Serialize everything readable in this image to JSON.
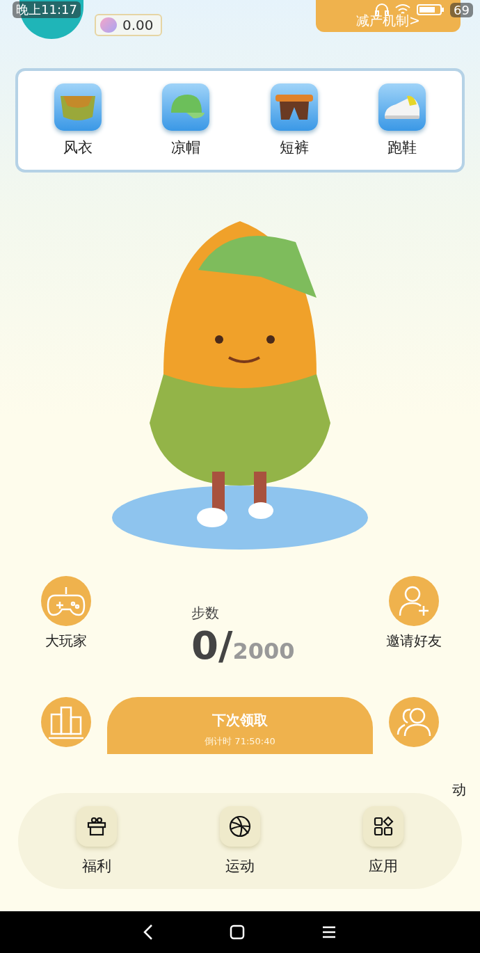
{
  "status_bar": {
    "time": "晚上11:17",
    "battery": "69"
  },
  "header": {
    "balance": "0.00",
    "mechanism_button": "减产机制>"
  },
  "outfits": [
    {
      "label": "风衣",
      "kind": "jacket"
    },
    {
      "label": "凉帽",
      "kind": "cap"
    },
    {
      "label": "短裤",
      "kind": "shorts"
    },
    {
      "label": "跑鞋",
      "kind": "shoe"
    }
  ],
  "steps": {
    "label": "步数",
    "current": "0/",
    "goal": "2000"
  },
  "side_actions": [
    {
      "label": "大玩家",
      "kind": "gamepad"
    },
    {
      "label": "邀请好友",
      "kind": "add-user"
    },
    {
      "kind": "podium"
    },
    {
      "label": "动",
      "kind": "users"
    }
  ],
  "claim_button": {
    "title": "下次领取",
    "countdown": "倒计时 71:50:40"
  },
  "dock": [
    {
      "label": "福利",
      "kind": "gift"
    },
    {
      "label": "运动",
      "kind": "ball"
    },
    {
      "label": "应用",
      "kind": "apps"
    }
  ]
}
